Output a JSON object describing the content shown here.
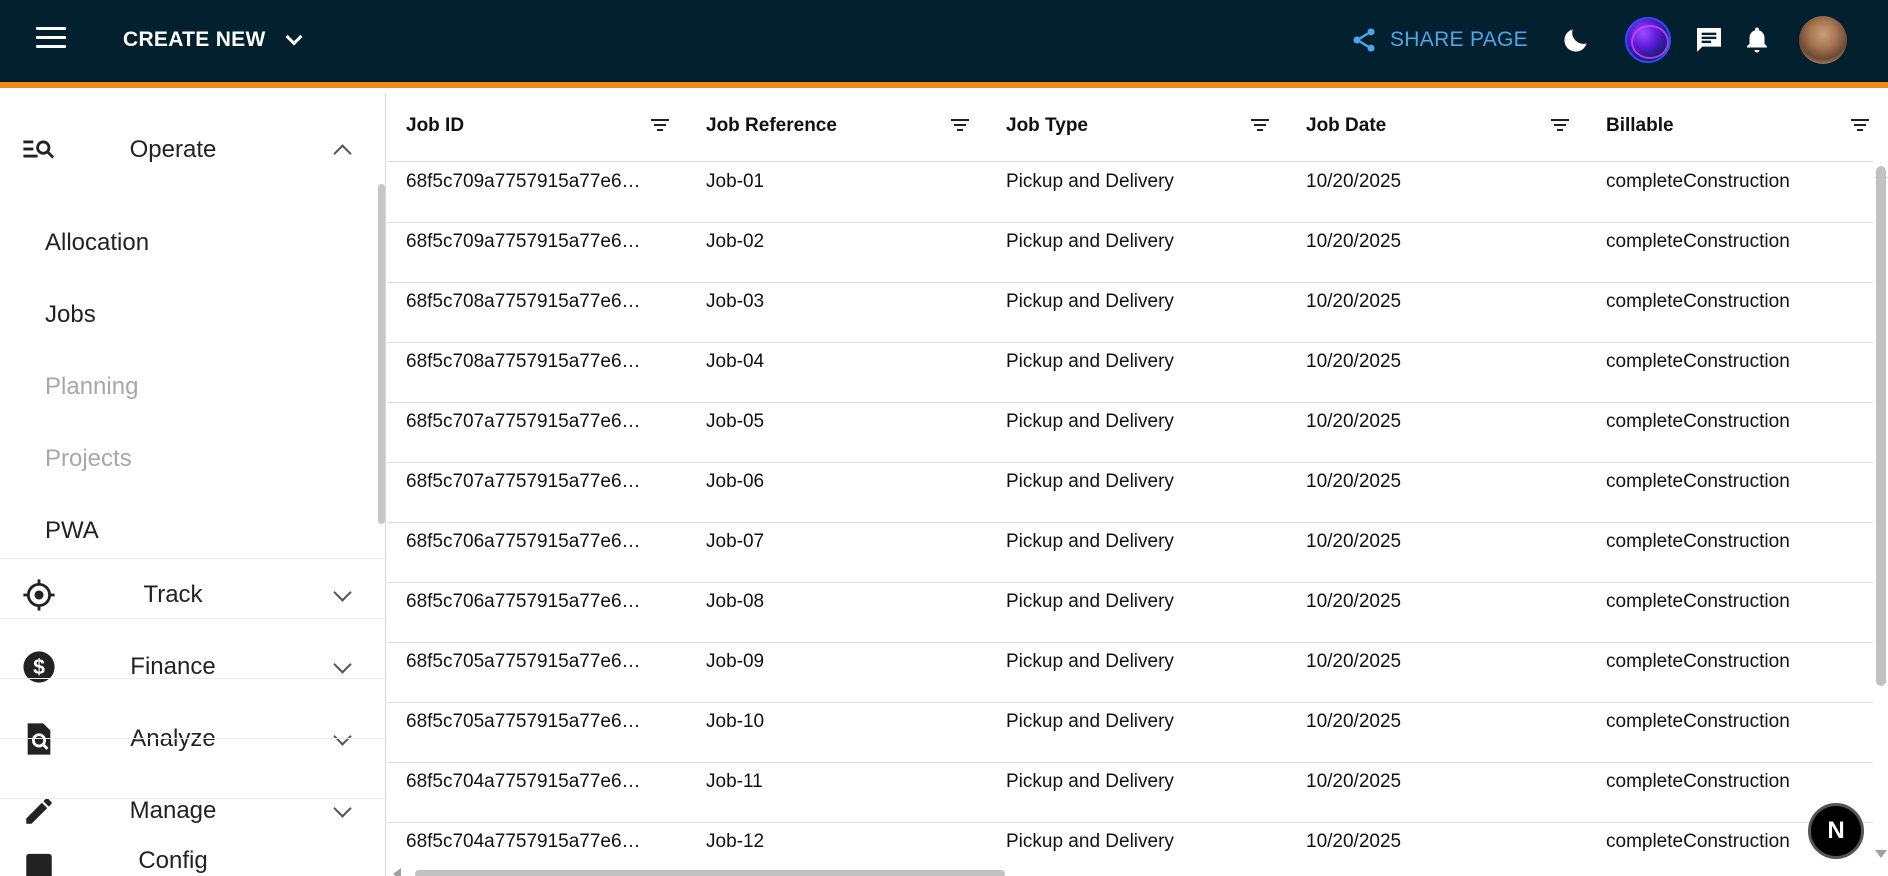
{
  "header": {
    "create_new_label": "CREATE NEW",
    "share_label": "SHARE PAGE",
    "icons": [
      "menu-icon",
      "chevron-down-icon",
      "share-icon",
      "moon-icon",
      "ai-orb-icon",
      "chat-icon",
      "bell-icon",
      "user-avatar"
    ],
    "colors": {
      "bar": "#03202f",
      "accent": "#f28a1b",
      "share": "#4ea6e8"
    }
  },
  "sidebar": {
    "operate": {
      "label": "Operate",
      "icon": "search-list-icon",
      "expanded": true
    },
    "sub_items": [
      {
        "label": "Allocation",
        "disabled": false
      },
      {
        "label": "Jobs",
        "disabled": false
      },
      {
        "label": "Planning",
        "disabled": true
      },
      {
        "label": "Projects",
        "disabled": true
      },
      {
        "label": "PWA",
        "disabled": false
      }
    ],
    "sections": [
      {
        "label": "Track",
        "icon": "target-icon"
      },
      {
        "label": "Finance",
        "icon": "dollar-icon"
      },
      {
        "label": "Analyze",
        "icon": "doc-search-icon"
      },
      {
        "label": "Manage",
        "icon": "pencil-icon"
      }
    ],
    "partial_label": "Config"
  },
  "table": {
    "columns": [
      "Job ID",
      "Job Reference",
      "Job Type",
      "Job Date",
      "Billable"
    ],
    "rows": [
      {
        "id": "68f5c709a7757915a77e6…",
        "ref": "Job-01",
        "type": "Pickup and Delivery",
        "date": "10/20/2025",
        "billable": "completeConstruction"
      },
      {
        "id": "68f5c709a7757915a77e6…",
        "ref": "Job-02",
        "type": "Pickup and Delivery",
        "date": "10/20/2025",
        "billable": "completeConstruction"
      },
      {
        "id": "68f5c708a7757915a77e6…",
        "ref": "Job-03",
        "type": "Pickup and Delivery",
        "date": "10/20/2025",
        "billable": "completeConstruction"
      },
      {
        "id": "68f5c708a7757915a77e6…",
        "ref": "Job-04",
        "type": "Pickup and Delivery",
        "date": "10/20/2025",
        "billable": "completeConstruction"
      },
      {
        "id": "68f5c707a7757915a77e6…",
        "ref": "Job-05",
        "type": "Pickup and Delivery",
        "date": "10/20/2025",
        "billable": "completeConstruction"
      },
      {
        "id": "68f5c707a7757915a77e6…",
        "ref": "Job-06",
        "type": "Pickup and Delivery",
        "date": "10/20/2025",
        "billable": "completeConstruction"
      },
      {
        "id": "68f5c706a7757915a77e6…",
        "ref": "Job-07",
        "type": "Pickup and Delivery",
        "date": "10/20/2025",
        "billable": "completeConstruction"
      },
      {
        "id": "68f5c706a7757915a77e6…",
        "ref": "Job-08",
        "type": "Pickup and Delivery",
        "date": "10/20/2025",
        "billable": "completeConstruction"
      },
      {
        "id": "68f5c705a7757915a77e6…",
        "ref": "Job-09",
        "type": "Pickup and Delivery",
        "date": "10/20/2025",
        "billable": "completeConstruction"
      },
      {
        "id": "68f5c705a7757915a77e6…",
        "ref": "Job-10",
        "type": "Pickup and Delivery",
        "date": "10/20/2025",
        "billable": "completeConstruction"
      },
      {
        "id": "68f5c704a7757915a77e6…",
        "ref": "Job-11",
        "type": "Pickup and Delivery",
        "date": "10/20/2025",
        "billable": "completeConstruction"
      },
      {
        "id": "68f5c704a7757915a77e6…",
        "ref": "Job-12",
        "type": "Pickup and Delivery",
        "date": "10/20/2025",
        "billable": "completeConstruction"
      }
    ]
  },
  "fab": {
    "label": "N"
  }
}
